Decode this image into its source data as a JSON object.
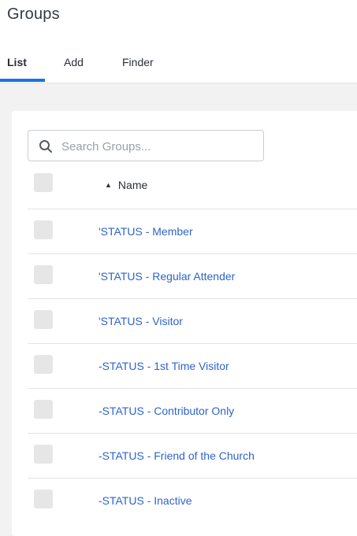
{
  "page": {
    "title": "Groups"
  },
  "tabs": [
    {
      "label": "List",
      "active": true
    },
    {
      "label": "Add",
      "active": false
    },
    {
      "label": "Finder",
      "active": false
    }
  ],
  "search": {
    "placeholder": "Search Groups...",
    "value": ""
  },
  "table": {
    "columns": [
      {
        "label": "Name",
        "sort": "ascending"
      }
    ],
    "rows": [
      {
        "name": "'STATUS - Member"
      },
      {
        "name": "'STATUS - Regular Attender"
      },
      {
        "name": "'STATUS - Visitor"
      },
      {
        "name": "-STATUS - 1st Time Visitor"
      },
      {
        "name": "-STATUS - Contributor Only"
      },
      {
        "name": "-STATUS - Friend of the Church"
      },
      {
        "name": "-STATUS - Inactive"
      }
    ]
  },
  "colors": {
    "accent": "#1a73e8",
    "link": "#2e64c9",
    "background": "#f2f2f2"
  }
}
